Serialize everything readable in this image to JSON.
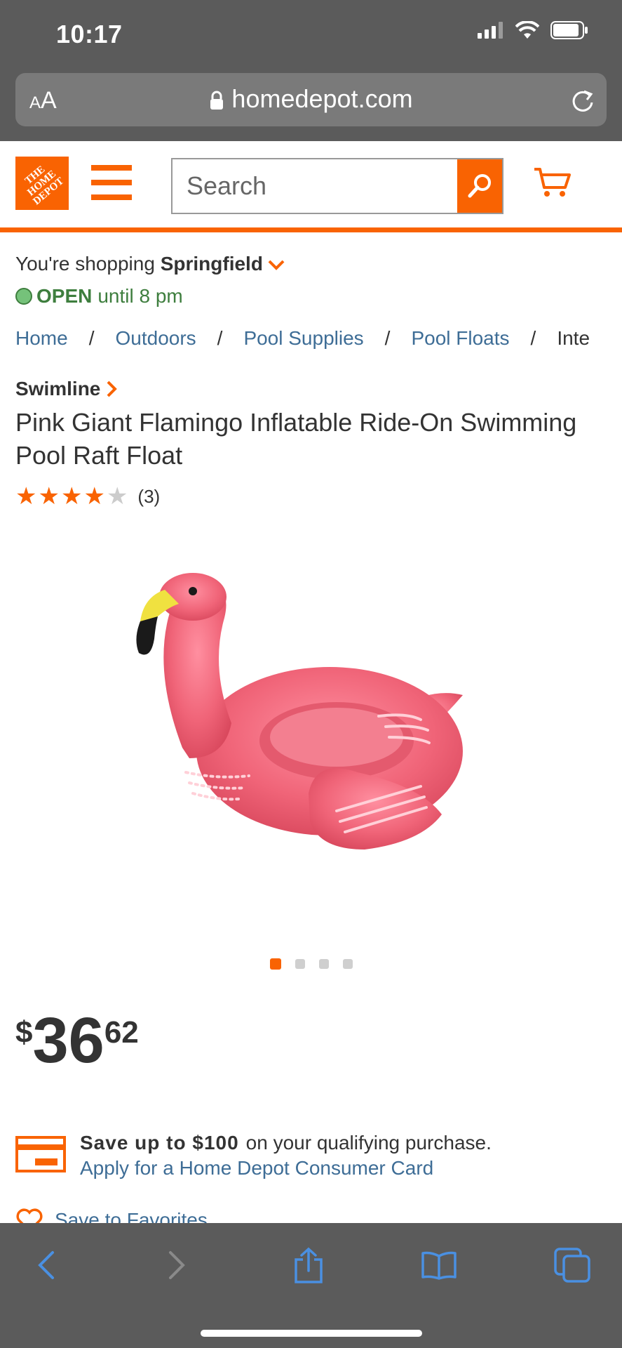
{
  "status": {
    "time": "10:17"
  },
  "browser": {
    "aa_label_small": "A",
    "aa_label_big": "A",
    "url": "homedepot.com"
  },
  "header": {
    "logo_text": "THE HOME DEPOT",
    "search_placeholder": "Search"
  },
  "store": {
    "prefix": "You're shopping ",
    "name": "Springfield",
    "open_label": "OPEN",
    "hours": "until 8 pm"
  },
  "breadcrumb": {
    "items": [
      "Home",
      "Outdoors",
      "Pool Supplies",
      "Pool Floats",
      "Inte"
    ],
    "separator": "/"
  },
  "product": {
    "brand": "Swimline",
    "title": "Pink Giant Flamingo Inflatable Ride-On Swimming Pool Raft Float",
    "rating": 4,
    "rating_max": 5,
    "review_count": "(3)",
    "image_count": 4,
    "active_image": 1,
    "price_currency": "$",
    "price_dollars": "36",
    "price_cents": "62"
  },
  "promo": {
    "bold": "Save up to $100",
    "text": "on your qualifying purchase.",
    "link": "Apply for a Home Depot Consumer Card"
  },
  "favorites_label": "Save to Favorites",
  "colors": {
    "brand_orange": "#f96302",
    "link_blue": "#3e6d96",
    "open_green": "#3e7e3e",
    "flamingo_pink": "#f06478",
    "chrome_gray": "#5b5b5b",
    "toolbar_blue": "#4a90e2"
  },
  "icons": [
    "signal-icon",
    "wifi-icon",
    "battery-icon",
    "lock-icon",
    "reload-icon",
    "menu-icon",
    "search-icon",
    "cart-icon",
    "chevron-down-icon",
    "chevron-right-icon",
    "credit-card-icon",
    "heart-icon",
    "back-icon",
    "forward-icon",
    "share-icon",
    "bookmarks-icon",
    "tabs-icon"
  ]
}
